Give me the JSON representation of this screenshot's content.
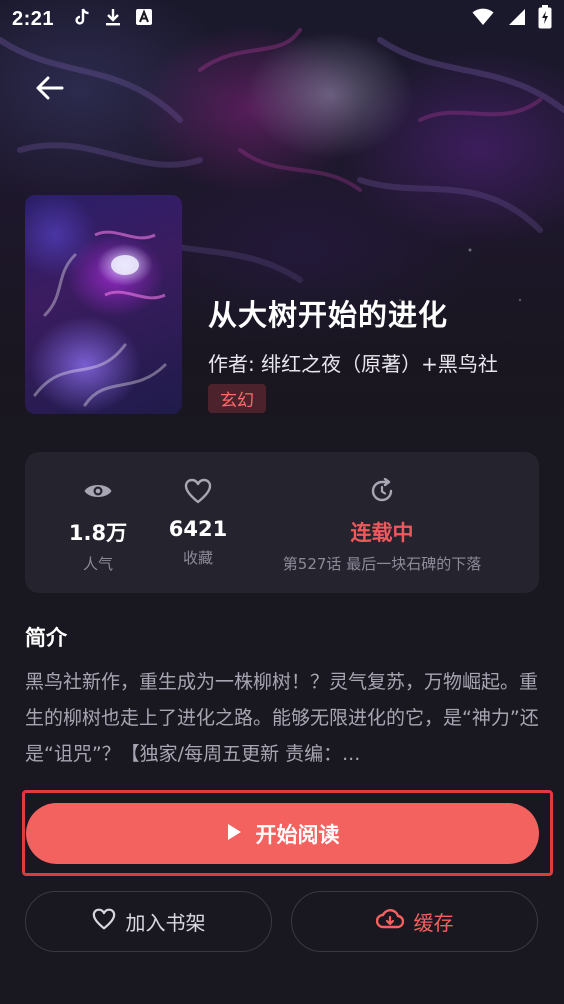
{
  "status_bar": {
    "time": "2:21",
    "icons": [
      "tiktok-icon",
      "download-icon",
      "font-icon",
      "wifi-icon",
      "signal-icon",
      "battery-charging-icon"
    ]
  },
  "book": {
    "title": "从大树开始的进化",
    "author": "作者: 绯红之夜（原著）+黑鸟社",
    "genre": "玄幻"
  },
  "stats": {
    "popularity": {
      "value": "1.8万",
      "label": "人气",
      "icon": "eye-icon"
    },
    "favorites": {
      "value": "6421",
      "label": "收藏",
      "icon": "heart-icon"
    },
    "update": {
      "status": "连载中",
      "latest": "第527话 最后一块石碑的下落",
      "icon": "refresh-icon"
    }
  },
  "intro": {
    "title": "简介",
    "text": "黑鸟社新作，重生成为一株柳树！？灵气复苏，万物崛起。重生的柳树也走上了进化之路。能够无限进化的它，是“神力”还是“诅咒”？【独家/每周五更新 责编：..."
  },
  "actions": {
    "read_label": "开始阅读",
    "shelf_label": "加入书架",
    "cache_label": "缓存"
  },
  "colors": {
    "accent": "#f4625f",
    "background": "#19171f",
    "card": "#25232e",
    "status_red": "#f0595c"
  }
}
